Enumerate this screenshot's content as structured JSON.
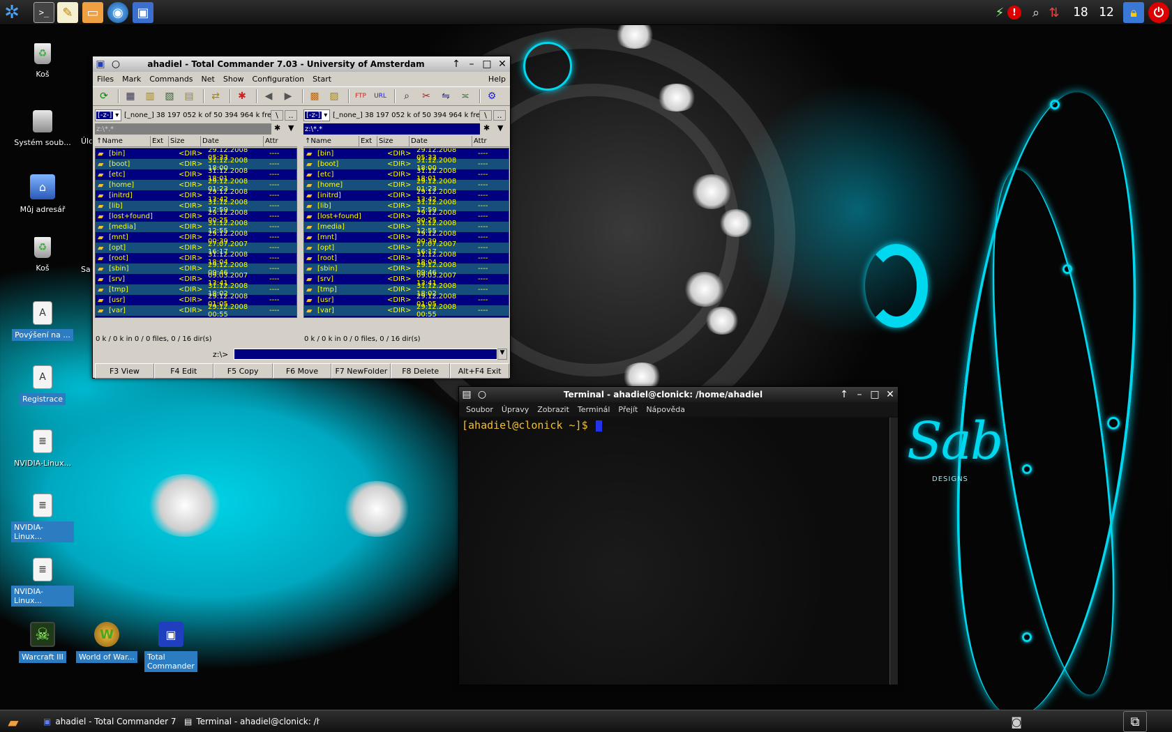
{
  "desktop": {
    "icons": [
      {
        "label": "Koš",
        "icon": "trash-icon"
      },
      {
        "label": "Systém soub...",
        "icon": "filesystem-icon"
      },
      {
        "label": "Můj adresář",
        "icon": "home-folder-icon"
      },
      {
        "label": "Koš",
        "icon": "trash-icon"
      },
      {
        "label": "Povýšení na ...",
        "icon": "document-icon"
      },
      {
        "label": "Registrace",
        "icon": "document-icon"
      },
      {
        "label": "NVIDIA-Linux...",
        "icon": "script-icon"
      },
      {
        "label": "NVIDIA-Linux...",
        "icon": "script-icon"
      },
      {
        "label": "NVIDIA-Linux...",
        "icon": "script-icon"
      },
      {
        "label": "Warcraft III",
        "icon": "warcraft-icon"
      },
      {
        "label": "World of War...",
        "icon": "wow-icon"
      },
      {
        "label": "Total Commander",
        "icon": "floppy-icon"
      }
    ],
    "partial_labels": [
      "Úlo",
      "Sa"
    ],
    "logo_text": "Sab",
    "logo_sub": "DESIGNS"
  },
  "top_panel": {
    "clock_hours": "18",
    "clock_minutes": "12",
    "launchers": [
      "kde-menu-icon",
      "terminal-icon",
      "text-editor-icon",
      "file-manager-icon",
      "browser-icon",
      "remote-desktop-icon"
    ],
    "tray": [
      "network-icon",
      "alert-icon",
      "search-icon",
      "update-icon",
      "lock-icon",
      "power-icon"
    ]
  },
  "tc": {
    "title": "ahadiel - Total Commander 7.03 - University of Amsterdam",
    "menu": [
      "Files",
      "Mark",
      "Commands",
      "Net",
      "Show",
      "Configuration",
      "Start"
    ],
    "help": "Help",
    "drive_letter": "[-z-]",
    "drive_info": "[_none_]  38 197 052 k of 50 394 964 k free",
    "root_btn": "\\",
    "up_btn": "..",
    "path": "z:\\*.*",
    "columns": [
      "↑Name",
      "Ext",
      "Size",
      "Date",
      "Attr"
    ],
    "files": [
      {
        "name": "[bin]",
        "size": "<DIR>",
        "date": "29.12.2008 05:33",
        "attr": "----"
      },
      {
        "name": "[boot]",
        "size": "<DIR>",
        "date": "31.12.2008 18:00",
        "attr": "----"
      },
      {
        "name": "[etc]",
        "size": "<DIR>",
        "date": "31.12.2008 18:01",
        "attr": "----"
      },
      {
        "name": "[home]",
        "size": "<DIR>",
        "date": "29.12.2008 01:23",
        "attr": "----"
      },
      {
        "name": "[initrd]",
        "size": "<DIR>",
        "date": "29.12.2008 13:42",
        "attr": "----"
      },
      {
        "name": "[lib]",
        "size": "<DIR>",
        "date": "31.12.2008 17:59",
        "attr": "----"
      },
      {
        "name": "[lost+found]",
        "size": "<DIR>",
        "date": "29.12.2008 00:25",
        "attr": "----"
      },
      {
        "name": "[media]",
        "size": "<DIR>",
        "date": "31.12.2008 12:55",
        "attr": "----"
      },
      {
        "name": "[mnt]",
        "size": "<DIR>",
        "date": "29.12.2008 00:39",
        "attr": "----"
      },
      {
        "name": "[opt]",
        "size": "<DIR>",
        "date": "27.07.2007 16:17",
        "attr": "----"
      },
      {
        "name": "[root]",
        "size": "<DIR>",
        "date": "31.12.2008 18:04",
        "attr": "----"
      },
      {
        "name": "[sbin]",
        "size": "<DIR>",
        "date": "29.12.2008 09:46",
        "attr": "----"
      },
      {
        "name": "[srv]",
        "size": "<DIR>",
        "date": "09.03.2007 13:41",
        "attr": "----"
      },
      {
        "name": "[tmp]",
        "size": "<DIR>",
        "date": "31.12.2008 18:02",
        "attr": "----"
      },
      {
        "name": "[usr]",
        "size": "<DIR>",
        "date": "29.12.2008 01:05",
        "attr": "----"
      },
      {
        "name": "[var]",
        "size": "<DIR>",
        "date": "29.12.2008 00:55",
        "attr": "----"
      }
    ],
    "status": "0 k / 0 k in 0 / 0 files, 0 / 16 dir(s)",
    "cmd_prompt": "z:\\>",
    "fkeys": [
      "F3 View",
      "F4 Edit",
      "F5 Copy",
      "F6 Move",
      "F7 NewFolder",
      "F8 Delete",
      "Alt+F4 Exit"
    ]
  },
  "terminal": {
    "title": "Terminal - ahadiel@clonick: /home/ahadiel",
    "menu": [
      "Soubor",
      "Úpravy",
      "Zobrazit",
      "Terminál",
      "Přejít",
      "Nápověda"
    ],
    "prompt": "[ahadiel@clonick ~]$ "
  },
  "taskbar": {
    "tasks": [
      "ahadiel - Total Commander 7....",
      "Terminal - ahadiel@clonick: /h..."
    ]
  }
}
